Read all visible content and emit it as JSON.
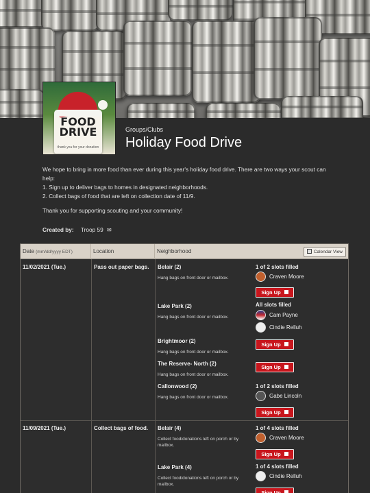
{
  "banner": {
    "alt": "food cans"
  },
  "logo": {
    "title_line1": "FOOD",
    "title_line2": "DRIVE",
    "subtitle": "thank you for your donation"
  },
  "header": {
    "category": "Groups/Clubs",
    "title": "Holiday Food Drive"
  },
  "description": {
    "intro": "We hope to bring in more food than ever during this year's holiday food drive.  There are two ways your scout can help:",
    "item1": "1. Sign up to deliver bags to homes in designated neighborhoods.",
    "item2": "2. Collect bags of food that are left on collection date of 11/9.",
    "thanks": "Thank you for supporting scouting and your community!"
  },
  "created_by": {
    "label": "Created by:",
    "value": "Troop 59"
  },
  "table": {
    "headers": {
      "date": "Date",
      "date_format": "(mm/dd/yyyy EDT)",
      "location": "Location",
      "neighborhood": "Neighborhood",
      "calendar_button": "Calendar View"
    },
    "signup_label": "Sign Up",
    "rows": [
      {
        "date": "11/02/2021 (Tue.)",
        "location": "Pass out paper bags."
      },
      {
        "date": "11/09/2021 (Tue.)",
        "location": "Collect bags of food."
      }
    ],
    "slots": [
      {
        "name": "Belair (2)",
        "desc": "Hang bags on front door or mailbox.",
        "status": "1 of 2 slots filled",
        "people": [
          "Craven Moore"
        ]
      },
      {
        "name": "Lake Park (2)",
        "desc": "Hang bags on front door or mailbox.",
        "status": "All slots filled",
        "people": [
          "Cam Payne",
          "Cindie Relluh"
        ]
      },
      {
        "name": "Brightmoor (2)",
        "desc": "Hang bags on front door or mailbox.",
        "status": "",
        "people": []
      },
      {
        "name": "The Reserve- North (2)",
        "desc": "Hang bags on front door or mailbox.",
        "status": "",
        "people": []
      },
      {
        "name": "Callonwood (2)",
        "desc": "Hang bags on front door or mailbox.",
        "status": "1 of 2 slots filled",
        "people": [
          "Gabe Lincoln"
        ]
      },
      {
        "name": "Belair (4)",
        "desc": "Collect food/donations left on porch or by mailbox.",
        "status": "1 of 4 slots filled",
        "people": [
          "Craven Moore"
        ]
      },
      {
        "name": "Lake Park (4)",
        "desc": "Collect food/donations left on porch or by mailbox.",
        "status": "1 of 4 slots filled",
        "people": [
          "Cindie Relluh"
        ]
      }
    ]
  },
  "colors": {
    "background": "#2b2b2b",
    "header_bg": "#d9d2c8",
    "signup_red": "#c8161d"
  },
  "icons": {
    "mail": "envelope-icon",
    "calendar": "calendar-icon",
    "signup": "square-icon"
  }
}
